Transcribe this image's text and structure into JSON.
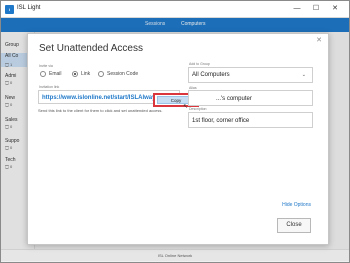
{
  "window": {
    "app_title": "ISL Light",
    "app_icon": "isl-logo-icon",
    "minimize_glyph": "—",
    "maximize_glyph": "☐",
    "close_glyph": "✕"
  },
  "topnav": {
    "tabs": [
      "Sessions",
      "Computers"
    ],
    "active_tab": "Computers"
  },
  "sidebar": {
    "header": "Group",
    "items": [
      {
        "label": "All Co",
        "sub": "🖵 1",
        "selected": true
      },
      {
        "label": "Admi",
        "sub": "🖵 0"
      },
      {
        "label": "New",
        "sub": "🖵 0"
      },
      {
        "label": "Sales",
        "sub": "🖵 0"
      },
      {
        "label": "Suppo",
        "sub": "🖵 0"
      },
      {
        "label": "Tech",
        "sub": "🖵 0"
      }
    ]
  },
  "statusbar": {
    "text": "ISL Online Network"
  },
  "dialog": {
    "title": "Set Unattended Access",
    "close_glyph": "✕",
    "invite_label": "Invite via",
    "invite_options": [
      {
        "label": "Email",
        "checked": false
      },
      {
        "label": "Link",
        "checked": true
      },
      {
        "label": "Session Code",
        "checked": false
      }
    ],
    "invitation_link_label": "Invitation link",
    "invitation_link": "https://www.islonline.net/start/ISLAlways",
    "copy_label": "Copy",
    "help_text": "Send this link to the client for them to click and set unattended access.",
    "add_to_group_label": "Add to Group",
    "group_value": "All Computers",
    "alias_label": "Alias",
    "alias_value": "...'s computer",
    "desc_label": "Description",
    "description_value": "1st floor, corner office",
    "hide_options_label": "Hide Options",
    "close_label": "Close"
  },
  "colors": {
    "accent": "#1f78c8",
    "highlight_border": "#d9363e"
  }
}
